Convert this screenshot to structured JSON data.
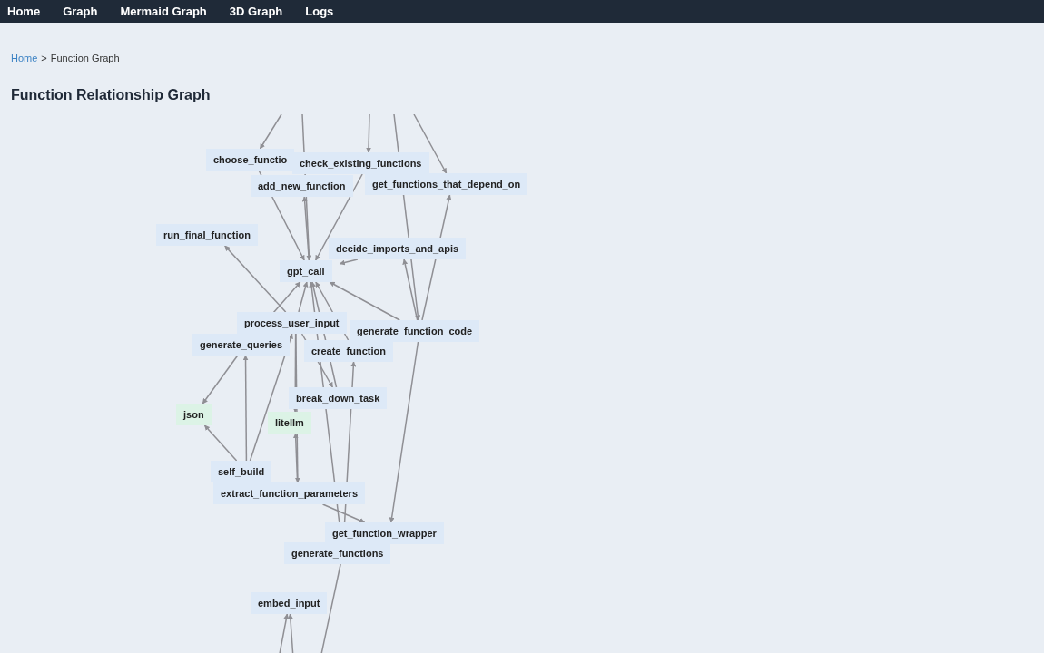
{
  "nav": [
    {
      "label": "Home"
    },
    {
      "label": "Graph"
    },
    {
      "label": "Mermaid Graph"
    },
    {
      "label": "3D Graph"
    },
    {
      "label": "Logs"
    }
  ],
  "breadcrumb": {
    "link": "Home",
    "separator": ">",
    "current": "Function Graph"
  },
  "title": "Function Relationship Graph",
  "graph": {
    "nodes": [
      {
        "label": "choose_functio",
        "kind": "function"
      },
      {
        "label": "add_new_function",
        "kind": "function"
      },
      {
        "label": "check_existing_functions",
        "kind": "function"
      },
      {
        "label": "get_functions_that_depend_on",
        "kind": "function"
      },
      {
        "label": "run_final_function",
        "kind": "function"
      },
      {
        "label": "decide_imports_and_apis",
        "kind": "function"
      },
      {
        "label": "gpt_call",
        "kind": "function"
      },
      {
        "label": "process_user_input",
        "kind": "function"
      },
      {
        "label": "generate_function_code",
        "kind": "function"
      },
      {
        "label": "generate_queries",
        "kind": "function"
      },
      {
        "label": "create_function",
        "kind": "function"
      },
      {
        "label": "break_down_task",
        "kind": "function"
      },
      {
        "label": "json",
        "kind": "module"
      },
      {
        "label": "litellm",
        "kind": "module"
      },
      {
        "label": "self_build",
        "kind": "function"
      },
      {
        "label": "extract_function_parameters",
        "kind": "function"
      },
      {
        "label": "get_function_wrapper",
        "kind": "function"
      },
      {
        "label": "generate_functions",
        "kind": "function"
      },
      {
        "label": "embed_input",
        "kind": "function"
      }
    ]
  }
}
